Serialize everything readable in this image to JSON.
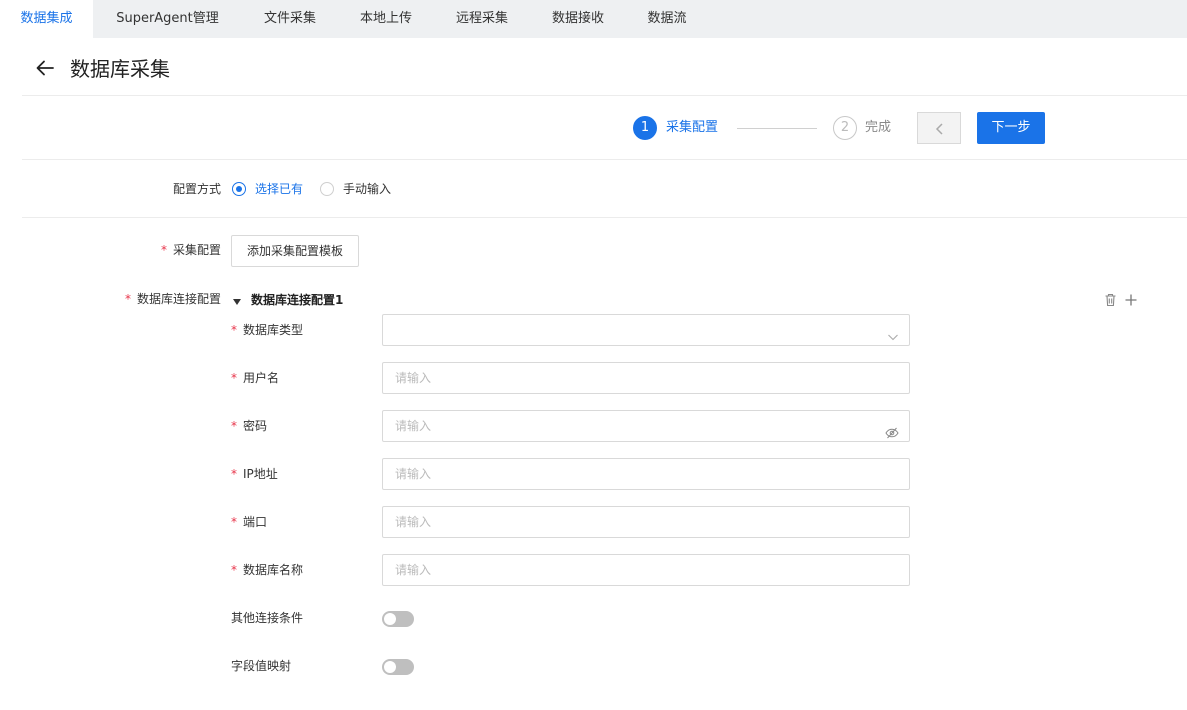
{
  "tabs": [
    {
      "label": "数据集成",
      "active": true
    },
    {
      "label": "SuperAgent管理",
      "active": false
    },
    {
      "label": "文件采集",
      "active": false
    },
    {
      "label": "本地上传",
      "active": false
    },
    {
      "label": "远程采集",
      "active": false
    },
    {
      "label": "数据接收",
      "active": false
    },
    {
      "label": "数据流",
      "active": false
    }
  ],
  "header": {
    "title": "数据库采集",
    "back_icon": "arrow-left-icon"
  },
  "steps": [
    {
      "number": "1",
      "label": "采集配置",
      "state": "active"
    },
    {
      "number": "2",
      "label": "完成",
      "state": "inactive"
    }
  ],
  "actions": {
    "prev_icon": "chevron-left-icon",
    "next_label": "下一步"
  },
  "config_mode": {
    "label": "配置方式",
    "options": [
      {
        "label": "选择已有",
        "checked": true
      },
      {
        "label": "手动输入",
        "checked": false
      }
    ]
  },
  "collect_config": {
    "label": "采集配置",
    "button_label": "添加采集配置模板"
  },
  "db_connection": {
    "label": "数据库连接配置",
    "section_title": "数据库连接配置1",
    "icons": [
      "caret-down-icon",
      "trash-icon",
      "plus-icon"
    ],
    "fields": [
      {
        "label": "数据库类型",
        "type": "select",
        "value": "",
        "placeholder": ""
      },
      {
        "label": "用户名",
        "type": "text",
        "value": "",
        "placeholder": "请输入"
      },
      {
        "label": "密码",
        "type": "password",
        "value": "",
        "placeholder": "请输入"
      },
      {
        "label": "IP地址",
        "type": "text",
        "value": "",
        "placeholder": "请输入"
      },
      {
        "label": "端口",
        "type": "text",
        "value": "",
        "placeholder": "请输入"
      },
      {
        "label": "数据库名称",
        "type": "text",
        "value": "",
        "placeholder": "请输入"
      }
    ],
    "toggles": [
      {
        "label": "其他连接条件",
        "on": false
      },
      {
        "label": "字段值映射",
        "on": false
      }
    ]
  },
  "colors": {
    "primary": "#1a73e8",
    "required": "#e8344a",
    "tab_bg": "#eef0f2"
  }
}
